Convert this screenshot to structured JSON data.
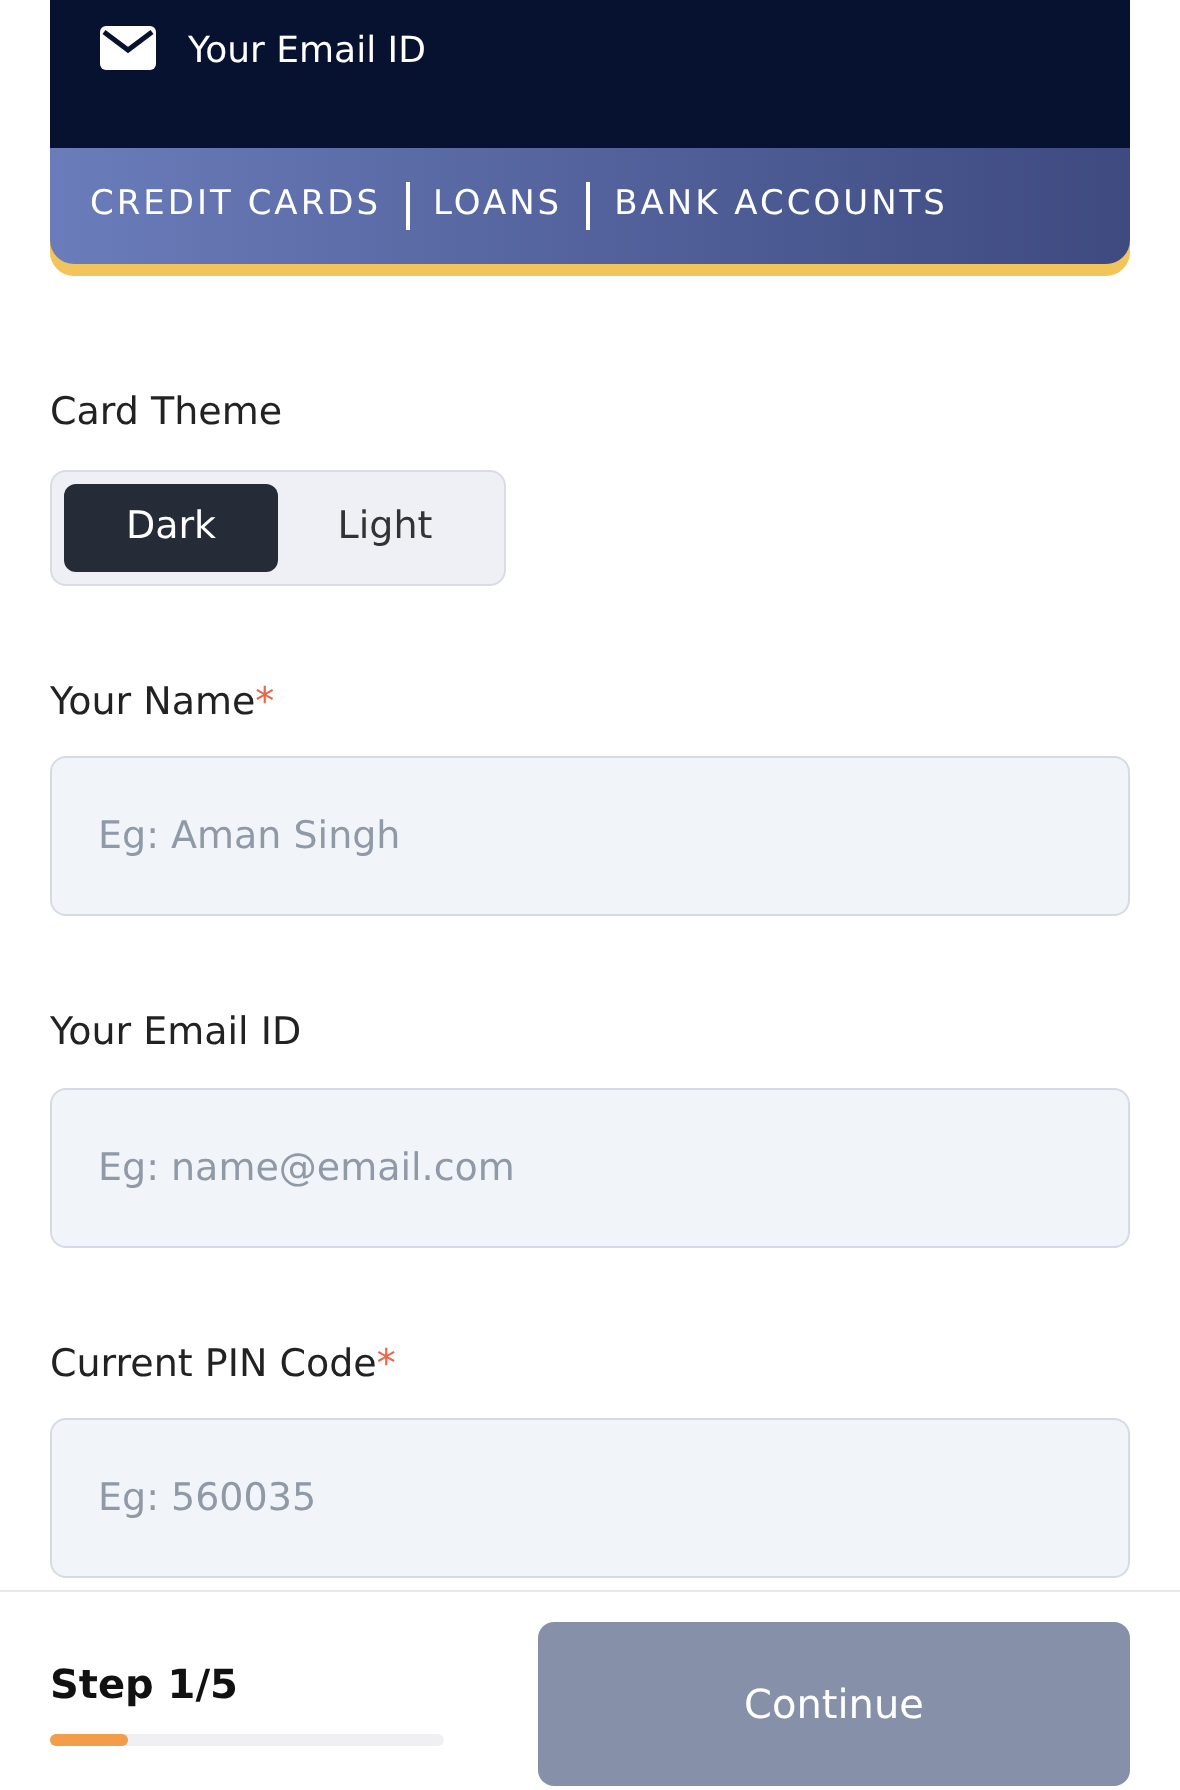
{
  "card": {
    "email_label": "Your Email ID",
    "categories": [
      "CREDIT CARDS",
      "LOANS",
      "BANK ACCOUNTS"
    ]
  },
  "theme": {
    "label": "Card Theme",
    "options": [
      {
        "label": "Dark",
        "selected": true
      },
      {
        "label": "Light",
        "selected": false
      }
    ]
  },
  "fields": [
    {
      "label": "Your Name",
      "required": true,
      "placeholder": "Eg: Aman Singh"
    },
    {
      "label": "Your Email ID",
      "required": false,
      "placeholder": "Eg: name@email.com"
    },
    {
      "label": "Current PIN Code",
      "required": true,
      "placeholder": "Eg: 560035"
    }
  ],
  "required_mark": "*",
  "footer": {
    "step": "Step 1/5",
    "level": 0.2,
    "button": {
      "label": "Continue",
      "disabled": true
    }
  }
}
